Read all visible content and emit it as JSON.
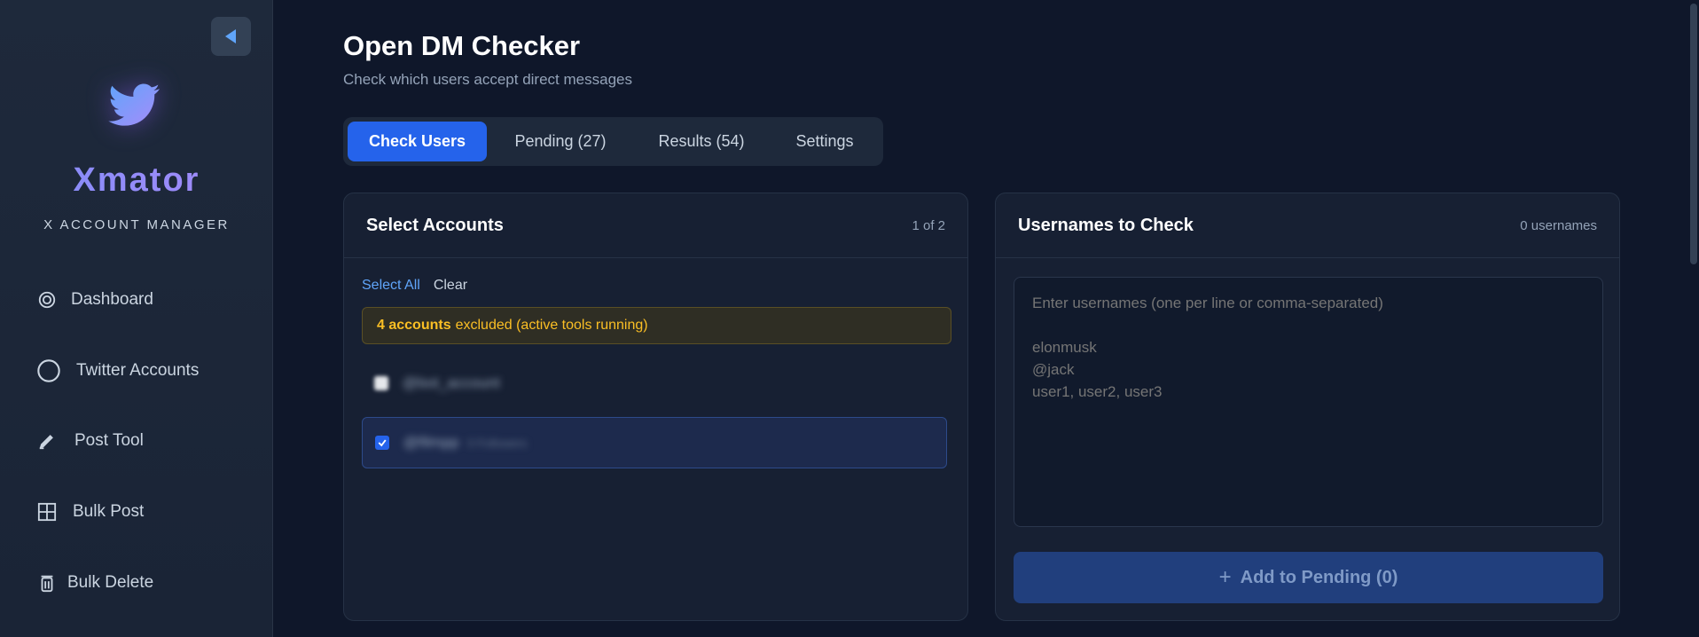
{
  "sidebar": {
    "brand": "Xmator",
    "brand_sub": "X ACCOUNT MANAGER",
    "items": [
      {
        "label": "Dashboard",
        "icon": "target-icon"
      },
      {
        "label": "Twitter Accounts",
        "icon": "circle-icon"
      },
      {
        "label": "Post Tool",
        "icon": "pencil-icon"
      },
      {
        "label": "Bulk Post",
        "icon": "grid-icon"
      },
      {
        "label": "Bulk Delete",
        "icon": "trash-icon"
      }
    ]
  },
  "header": {
    "title": "Open DM Checker",
    "subtitle": "Check which users accept direct messages"
  },
  "tabs": [
    {
      "label": "Check Users",
      "active": true
    },
    {
      "label": "Pending (27)",
      "active": false
    },
    {
      "label": "Results (54)",
      "active": false
    },
    {
      "label": "Settings",
      "active": false
    }
  ],
  "accounts_card": {
    "title": "Select Accounts",
    "count": "1 of 2",
    "select_all": "Select All",
    "clear": "Clear",
    "warning_bold": "4 accounts",
    "warning_rest": "excluded (active tools running)",
    "accounts": [
      {
        "handle": "@bot_account",
        "followers": "",
        "checked": false
      },
      {
        "handle": "@filmpp",
        "followers": "0 Followers",
        "checked": true
      }
    ]
  },
  "usernames_card": {
    "title": "Usernames to Check",
    "count": "0 usernames",
    "placeholder": "Enter usernames (one per line or comma-separated)\n\nelonmusk\n@jack\nuser1, user2, user3",
    "add_button": "Add to Pending (0)"
  },
  "colors": {
    "accent": "#2563eb",
    "warning": "#fbbf24",
    "brand_gradient_start": "#818cf8",
    "brand_gradient_end": "#a78bfa"
  }
}
